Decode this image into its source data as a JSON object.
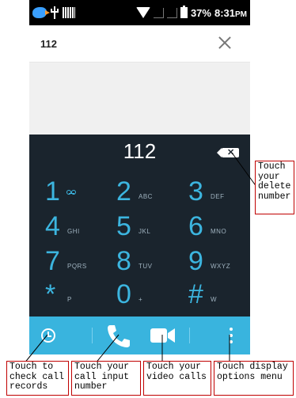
{
  "status_bar": {
    "battery": "37%",
    "time": "8:31",
    "ampm": "PM"
  },
  "input_bar": {
    "value": "112"
  },
  "dialpad": {
    "display": "112",
    "keys": [
      {
        "digit": "1",
        "letters": ""
      },
      {
        "digit": "2",
        "letters": "ABC"
      },
      {
        "digit": "3",
        "letters": "DEF"
      },
      {
        "digit": "4",
        "letters": "GHI"
      },
      {
        "digit": "5",
        "letters": "JKL"
      },
      {
        "digit": "6",
        "letters": "MNO"
      },
      {
        "digit": "7",
        "letters": "PQRS"
      },
      {
        "digit": "8",
        "letters": "TUV"
      },
      {
        "digit": "9",
        "letters": "WXYZ"
      },
      {
        "digit": "*",
        "letters": "P"
      },
      {
        "digit": "0",
        "letters": "+"
      },
      {
        "digit": "#",
        "letters": "W"
      }
    ]
  },
  "bottom_bar": {
    "icons": [
      "history-icon",
      "phone-icon",
      "video-icon",
      "menu-icon"
    ]
  },
  "callouts": {
    "delete": "Touch\nyour\ndelete\nnumber",
    "records": "Touch to\ncheck call\nrecords",
    "input": "Touch your\ncall input\nnumber",
    "video": "Touch your\nvideo calls",
    "menu": "Touch display\noptions menu"
  },
  "colors": {
    "accent": "#39b4de",
    "digit": "#3cb5df",
    "dialpad_bg": "#1a242d",
    "callout_border": "#c00000"
  }
}
